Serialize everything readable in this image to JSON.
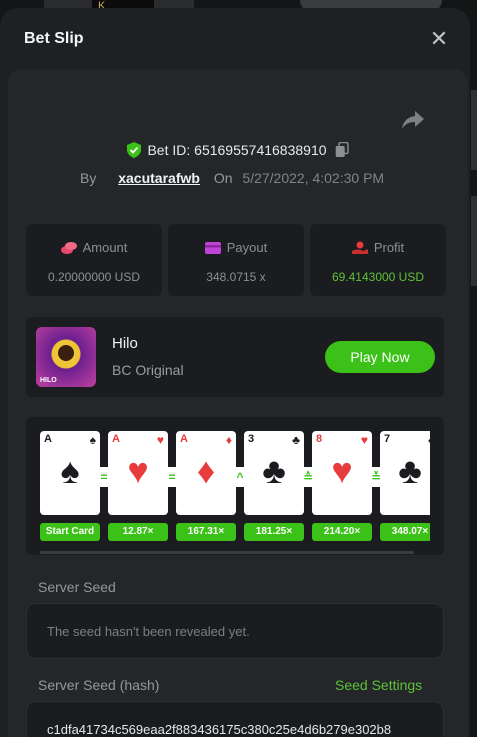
{
  "modal": {
    "title": "Bet Slip",
    "close_icon": "close-icon",
    "share_icon": "share-icon"
  },
  "bet": {
    "id_label": "Bet ID: 65169557416838910",
    "by_label": "By",
    "user": "xacutarafwb",
    "on_label": "On",
    "date": "5/27/2022, 4:02:30 PM"
  },
  "stats": {
    "amount": {
      "label": "Amount",
      "value": "0.20000000 USD",
      "icon": "coins-icon",
      "color": "#e84a6d"
    },
    "payout": {
      "label": "Payout",
      "value": "348.0715 x",
      "icon": "wallet-icon",
      "color": "#c042d6"
    },
    "profit": {
      "label": "Profit",
      "value": "69.4143000 USD",
      "icon": "hand-coins-icon",
      "color": "#e63b3b"
    }
  },
  "game": {
    "name": "Hilo",
    "subtitle": "BC Original",
    "play_label": "Play Now",
    "thumb_tag": "HILO"
  },
  "cards": [
    {
      "rank": "A",
      "suit": "♠",
      "color": "black",
      "label": "Start Card"
    },
    {
      "rank": "A",
      "suit": "♥",
      "color": "red",
      "label": "12.87×"
    },
    {
      "rank": "A",
      "suit": "♦",
      "color": "red",
      "label": "167.31×"
    },
    {
      "rank": "3",
      "suit": "♣",
      "color": "black",
      "label": "181.25×"
    },
    {
      "rank": "8",
      "suit": "♥",
      "color": "red",
      "label": "214.20×"
    },
    {
      "rank": "7",
      "suit": "♣",
      "color": "black",
      "label": "348.07×"
    }
  ],
  "guesses": [
    "=",
    "=",
    "^",
    "≙",
    "≚"
  ],
  "server_seed": {
    "label": "Server Seed",
    "value": "The seed hasn't been revealed yet."
  },
  "server_seed_hash": {
    "label": "Server Seed (hash)",
    "settings_label": "Seed Settings",
    "value": "c1dfa41734c569eaa2f883436175c380c25e4d6b279e302b8"
  },
  "colors": {
    "accent": "#3bc117",
    "profit": "#5bc236",
    "panel": "#1b1c1f"
  }
}
